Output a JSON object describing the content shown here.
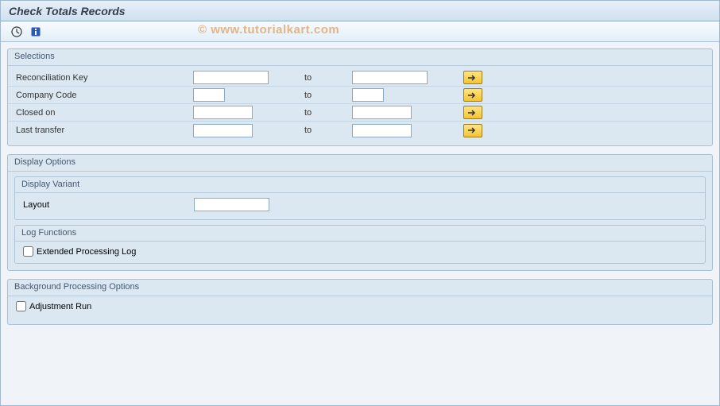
{
  "window": {
    "title": "Check Totals Records"
  },
  "watermark": "© www.tutorialkart.com",
  "toolbar": {
    "execute_icon": "execute-icon",
    "info_icon": "info-icon"
  },
  "selections": {
    "title": "Selections",
    "rows": [
      {
        "label": "Reconciliation Key",
        "to": "to",
        "from_val": "",
        "to_val": "",
        "size": "wide"
      },
      {
        "label": "Company Code",
        "to": "to",
        "from_val": "",
        "to_val": "",
        "size": "short"
      },
      {
        "label": "Closed on",
        "to": "to",
        "from_val": "",
        "to_val": "",
        "size": "med"
      },
      {
        "label": "Last transfer",
        "to": "to",
        "from_val": "",
        "to_val": "",
        "size": "med"
      }
    ]
  },
  "display_options": {
    "title": "Display Options",
    "display_variant": {
      "title": "Display Variant",
      "layout_label": "Layout",
      "layout_value": ""
    },
    "log_functions": {
      "title": "Log Functions",
      "extended_log_label": "Extended Processing Log",
      "extended_log_checked": false
    }
  },
  "bg_options": {
    "title": "Background Processing Options",
    "adjustment_run_label": "Adjustment Run",
    "adjustment_run_checked": false
  }
}
